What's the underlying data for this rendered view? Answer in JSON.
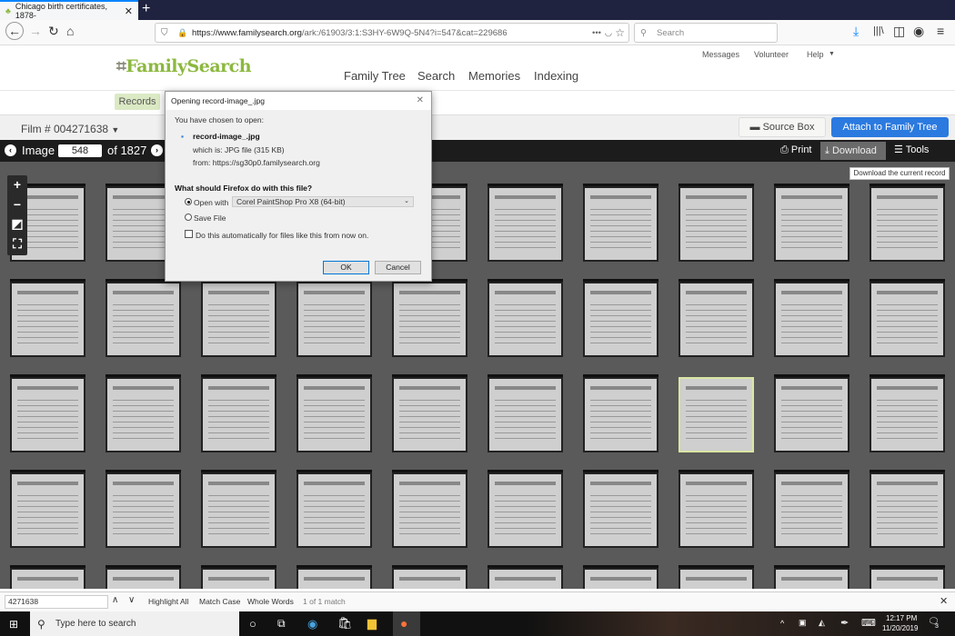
{
  "browser": {
    "tab_title": "Chicago birth certificates, 1878-",
    "url_domain": "https://www.familysearch.org",
    "url_path": "/ark:/61903/3:1:S3HY-6W9Q-5N4?i=547&cat=229686",
    "search_placeholder": "Search"
  },
  "site": {
    "logo": "FamilySearch",
    "top_links": [
      "Messages",
      "Volunteer",
      "Help"
    ],
    "main_nav": [
      "Family Tree",
      "Search",
      "Memories",
      "Indexing"
    ],
    "records_tab": "Records",
    "film_label": "Film # 004271638",
    "source_box": "Source Box",
    "attach": "Attach to Family Tree"
  },
  "viewer": {
    "image_label": "Image",
    "current_image": "548",
    "of_label": "of 1827",
    "print": "Print",
    "download": "Download",
    "tools": "Tools",
    "tooltip": "Download the current record",
    "selected_thumb_row": 3,
    "selected_thumb_col": 8
  },
  "dialog": {
    "title": "Opening record-image_.jpg",
    "chosen": "You have chosen to open:",
    "filename": "record-image_.jpg",
    "which_is": "which is:  JPG file (315 KB)",
    "from": "from:  https://sg30p0.familysearch.org",
    "question": "What should Firefox do with this file?",
    "open_with": "Open with",
    "app": "Corel PaintShop Pro X8 (64-bit)",
    "save_file": "Save File",
    "auto": "Do this automatically for files like this from now on.",
    "ok": "OK",
    "cancel": "Cancel",
    "selected_option": "Open with"
  },
  "findbar": {
    "value": "4271638",
    "highlight_all": "Highlight All",
    "match_case": "Match Case",
    "whole_words": "Whole Words",
    "status": "1 of 1 match"
  },
  "taskbar": {
    "search_placeholder": "Type here to search",
    "time": "12:17 PM",
    "date": "11/20/2019",
    "notifications": "3"
  }
}
